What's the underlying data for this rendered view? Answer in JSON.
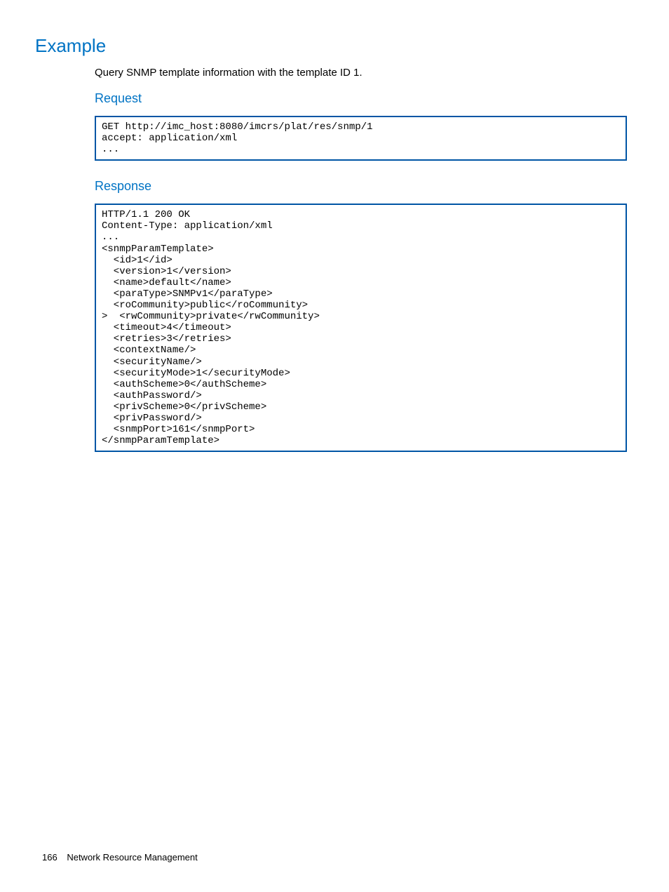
{
  "headings": {
    "example": "Example",
    "request": "Request",
    "response": "Response"
  },
  "intro_text": "Query SNMP template information with the template ID 1.",
  "request_code": "GET http://imc_host:8080/imcrs/plat/res/snmp/1\naccept: application/xml\n...",
  "response_code": "HTTP/1.1 200 OK\nContent-Type: application/xml\n...\n<snmpParamTemplate>\n  <id>1</id>\n  <version>1</version>\n  <name>default</name>\n  <paraType>SNMPv1</paraType>\n  <roCommunity>public</roCommunity>\n>  <rwCommunity>private</rwCommunity>\n  <timeout>4</timeout>\n  <retries>3</retries>\n  <contextName/>\n  <securityName/>\n  <securityMode>1</securityMode>\n  <authScheme>0</authScheme>\n  <authPassword/>\n  <privScheme>0</privScheme>\n  <privPassword/>\n  <snmpPort>161</snmpPort>\n</snmpParamTemplate>",
  "footer": {
    "page_number": "166",
    "section": "Network Resource Management"
  }
}
